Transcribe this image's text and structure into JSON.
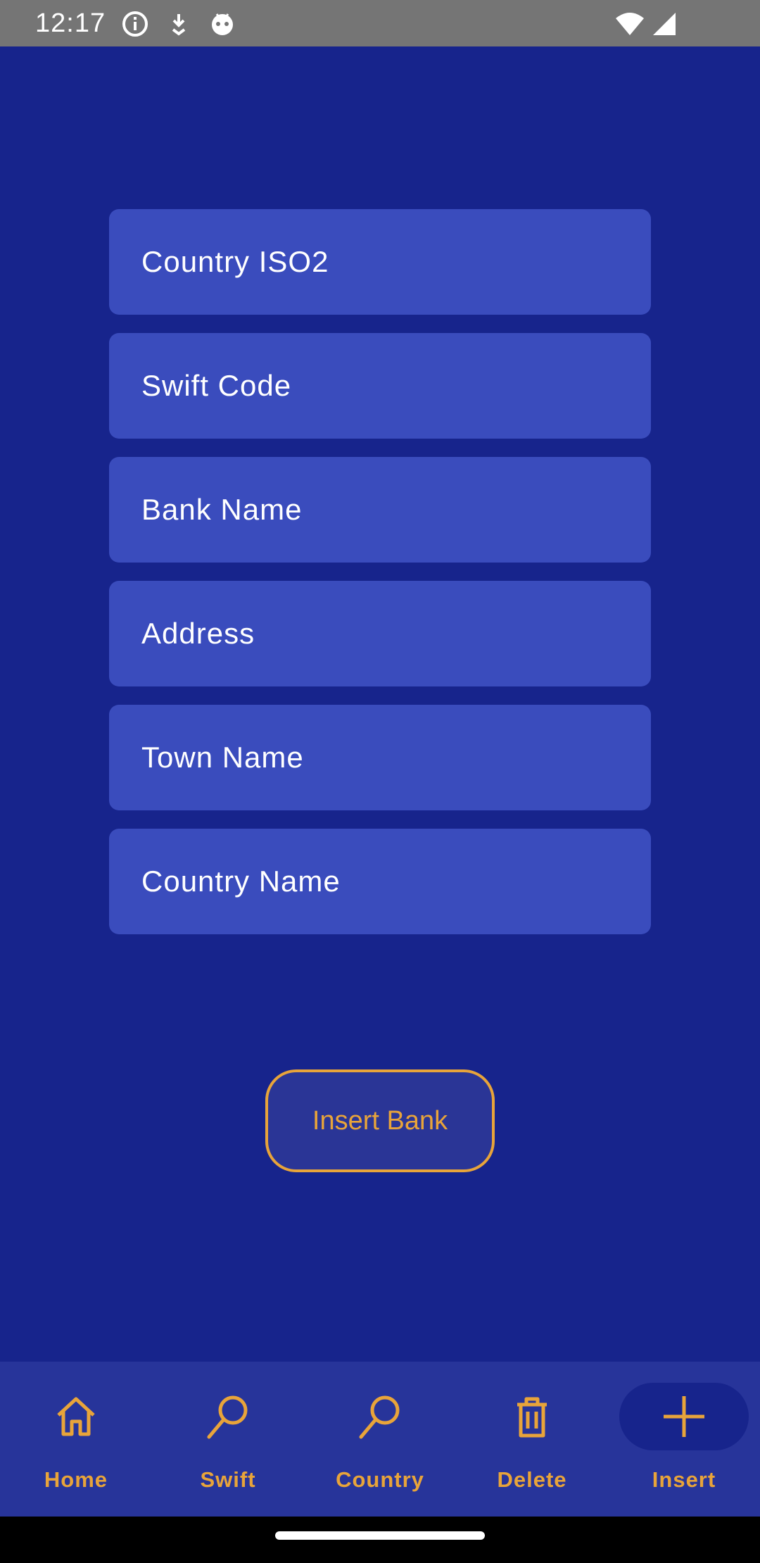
{
  "status_bar": {
    "time": "12:17",
    "left_icons": [
      "info-icon",
      "download-icon",
      "android-icon"
    ],
    "right_icons": [
      "wifi-icon",
      "signal-icon"
    ]
  },
  "form": {
    "fields": [
      {
        "name": "country-iso2",
        "placeholder": "Country ISO2"
      },
      {
        "name": "swift-code",
        "placeholder": "Swift Code"
      },
      {
        "name": "bank-name",
        "placeholder": "Bank Name"
      },
      {
        "name": "address",
        "placeholder": "Address"
      },
      {
        "name": "town-name",
        "placeholder": "Town Name"
      },
      {
        "name": "country-name",
        "placeholder": "Country Name"
      }
    ],
    "submit_label": "Insert Bank"
  },
  "bottom_nav": {
    "items": [
      {
        "label": "Home",
        "icon": "home-icon"
      },
      {
        "label": "Swift",
        "icon": "search-icon"
      },
      {
        "label": "Country",
        "icon": "search-icon"
      },
      {
        "label": "Delete",
        "icon": "trash-icon"
      },
      {
        "label": "Insert",
        "icon": "plus-icon",
        "active": true
      }
    ]
  },
  "colors": {
    "background": "#17248c",
    "field": "#3a4cbd",
    "accent": "#e8a43a",
    "nav_background": "#27349a",
    "status_bar": "#757575"
  }
}
